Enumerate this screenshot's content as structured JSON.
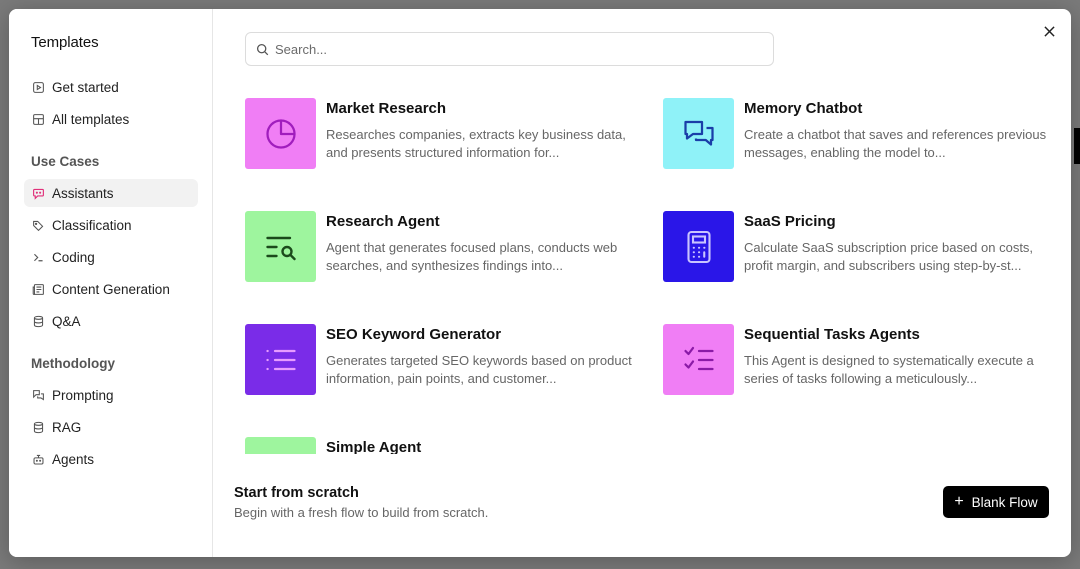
{
  "dialog": {
    "close_icon": "close-icon"
  },
  "sidebar": {
    "title": "Templates",
    "top_items": [
      {
        "label": "Get started",
        "icon": "play-square-icon"
      },
      {
        "label": "All templates",
        "icon": "layout-grid-icon"
      }
    ],
    "use_cases_heading": "Use Cases",
    "use_cases": [
      {
        "label": "Assistants",
        "icon": "bot-message-icon",
        "active": true
      },
      {
        "label": "Classification",
        "icon": "tags-icon"
      },
      {
        "label": "Coding",
        "icon": "terminal-icon"
      },
      {
        "label": "Content Generation",
        "icon": "newspaper-icon"
      },
      {
        "label": "Q&A",
        "icon": "database-icon"
      }
    ],
    "methodology_heading": "Methodology",
    "methodology": [
      {
        "label": "Prompting",
        "icon": "chat-bubbles-icon"
      },
      {
        "label": "RAG",
        "icon": "database-icon"
      },
      {
        "label": "Agents",
        "icon": "bot-icon"
      }
    ]
  },
  "search": {
    "placeholder": "Search...",
    "value": ""
  },
  "templates": [
    {
      "title": "Market Research",
      "description": "Researches companies, extracts key business data, and presents structured information for...",
      "color": "#f07ef5",
      "icon": "pie-chart-icon"
    },
    {
      "title": "Memory Chatbot",
      "description": "Create a chatbot that saves and references previous messages, enabling the model to...",
      "color": "#8ff2f8",
      "icon": "chat-bubbles-icon"
    },
    {
      "title": "Research Agent",
      "description": "Agent that generates focused plans, conducts web searches, and synthesizes findings into...",
      "color": "#9ef59e",
      "icon": "text-search-icon"
    },
    {
      "title": "SaaS Pricing",
      "description": "Calculate SaaS subscription price based on costs, profit margin, and subscribers using step-by-st...",
      "color": "#2a16e8",
      "icon": "calculator-icon"
    },
    {
      "title": "SEO Keyword Generator",
      "description": "Generates targeted SEO keywords based on product information, pain points, and customer...",
      "color": "#7a2ce8",
      "icon": "list-icon"
    },
    {
      "title": "Sequential Tasks Agents",
      "description": "This Agent is designed to systematically execute a series of tasks following a meticulously...",
      "color": "#f07ef5",
      "icon": "list-checks-icon"
    },
    {
      "title": "Simple Agent",
      "description": "",
      "color": "#9ef59e",
      "icon": "bot-icon"
    }
  ],
  "footer": {
    "title": "Start from scratch",
    "description": "Begin with a fresh flow to build from scratch.",
    "button_label": "Blank Flow",
    "button_icon": "plus-icon"
  }
}
